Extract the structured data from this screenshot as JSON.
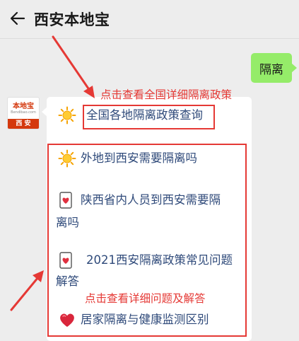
{
  "header": {
    "title": "西安本地宝",
    "back_icon": "arrow-left-icon"
  },
  "chat": {
    "user_message": "隔离",
    "avatar": {
      "brand": "本地宝",
      "site": "Bendibao.com",
      "city": "西 安"
    },
    "bot_reply": {
      "items": [
        {
          "icon": "sun-icon",
          "label": "全国各地隔离政策查询"
        },
        {
          "icon": "sun-icon",
          "label": "外地到西安需要隔离吗"
        },
        {
          "icon": "memo-heart-icon",
          "label_line1": "陕西省内人员到西安需要隔",
          "label_line2": "离吗"
        },
        {
          "icon": "memo-heart-icon",
          "label_line1": "2021西安隔离政策常见问题",
          "label_line2": "解答"
        },
        {
          "icon": "heart-icon",
          "label": "居家隔离与健康监测区别"
        }
      ]
    }
  },
  "annotations": {
    "top_note": "点击查看全国详细隔离政策",
    "bottom_note": "点击查看详细问题及解答",
    "color": "#e53935"
  },
  "colors": {
    "background": "#ededed",
    "user_bubble": "#95ec69",
    "link_text": "#2f4a7a",
    "brand_red": "#d4380d"
  }
}
